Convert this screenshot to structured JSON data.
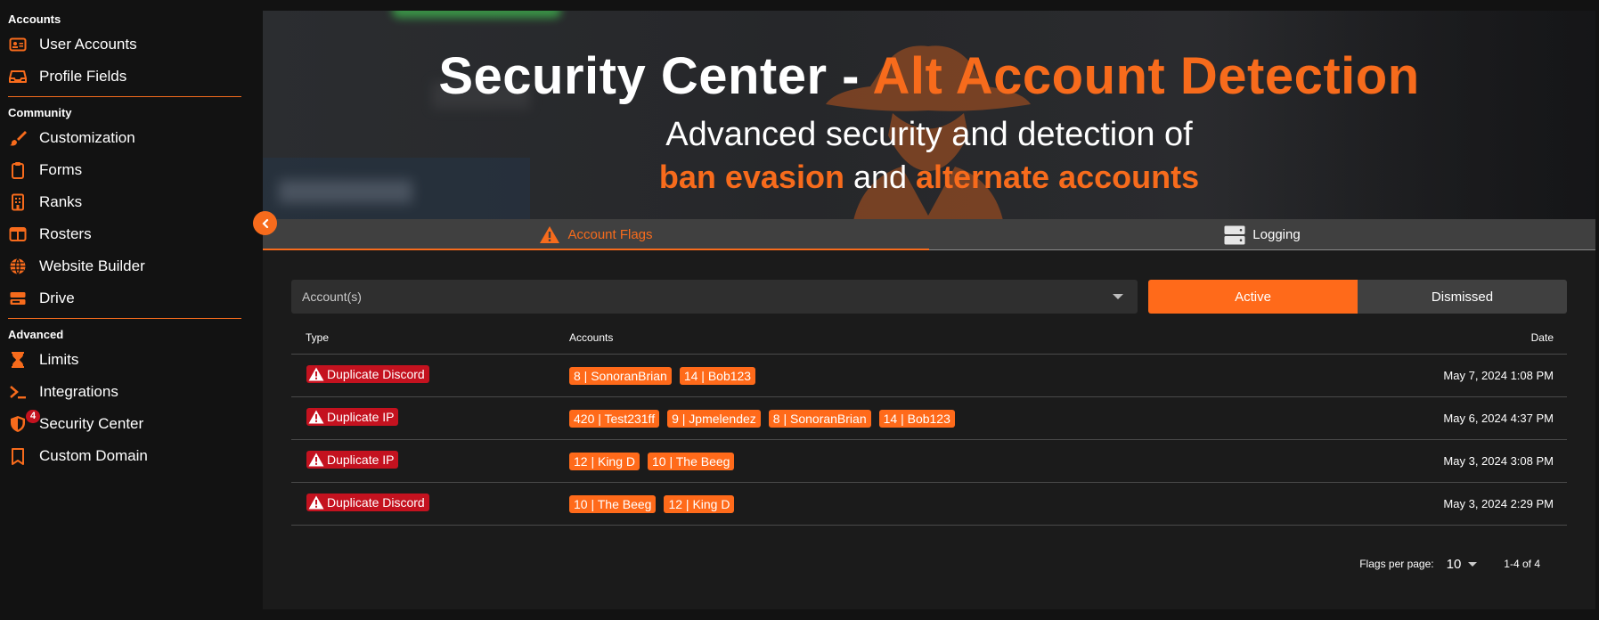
{
  "sidebar": {
    "sections": [
      {
        "title": "Accounts",
        "items": [
          {
            "label": "User Accounts",
            "icon": "id-card-icon"
          },
          {
            "label": "Profile Fields",
            "icon": "inbox-icon"
          }
        ]
      },
      {
        "title": "Community",
        "items": [
          {
            "label": "Customization",
            "icon": "paintbrush-icon"
          },
          {
            "label": "Forms",
            "icon": "clipboard-icon"
          },
          {
            "label": "Ranks",
            "icon": "building-icon"
          },
          {
            "label": "Rosters",
            "icon": "columns-icon"
          },
          {
            "label": "Website Builder",
            "icon": "globe-icon"
          },
          {
            "label": "Drive",
            "icon": "server-icon"
          }
        ]
      },
      {
        "title": "Advanced",
        "items": [
          {
            "label": "Limits",
            "icon": "hourglass-icon"
          },
          {
            "label": "Integrations",
            "icon": "terminal-icon"
          },
          {
            "label": "Security Center",
            "icon": "shield-icon",
            "badge": "4"
          },
          {
            "label": "Custom Domain",
            "icon": "bookmark-icon"
          }
        ]
      }
    ]
  },
  "header": {
    "title_white": "Security Center - ",
    "title_orange": "Alt Account Detection",
    "subtitle_line1": "Advanced security and detection of",
    "subtitle_bold1": "ban evasion",
    "subtitle_mid": " and ",
    "subtitle_bold2": "alternate accounts"
  },
  "tabs": [
    {
      "label": "Account Flags",
      "active": true,
      "icon": "warning-icon"
    },
    {
      "label": "Logging",
      "active": false,
      "icon": "server-icon"
    }
  ],
  "filters": {
    "account_placeholder": "Account(s)",
    "toggle": [
      "Active",
      "Dismissed"
    ],
    "toggle_selected": "Active"
  },
  "table": {
    "headers": {
      "type": "Type",
      "accounts": "Accounts",
      "date": "Date"
    },
    "rows": [
      {
        "type": "Duplicate Discord",
        "accounts": [
          "8 | SonoranBrian",
          "14 | Bob123"
        ],
        "date": "May 7, 2024 1:08 PM"
      },
      {
        "type": "Duplicate IP",
        "accounts": [
          "420 | Test231ff",
          "9 | Jpmelendez",
          "8 | SonoranBrian",
          "14 | Bob123"
        ],
        "date": "May 6, 2024 4:37 PM"
      },
      {
        "type": "Duplicate IP",
        "accounts": [
          "12 | King D",
          "10 | The Beeg"
        ],
        "date": "May 3, 2024 3:08 PM"
      },
      {
        "type": "Duplicate Discord",
        "accounts": [
          "10 | The Beeg",
          "12 | King D"
        ],
        "date": "May 3, 2024 2:29 PM"
      }
    ]
  },
  "pagination": {
    "per_page_label": "Flags per page:",
    "per_page_value": "10",
    "range": "1-4 of 4"
  },
  "colors": {
    "accent": "#f76b1c",
    "danger": "#c4121f"
  }
}
